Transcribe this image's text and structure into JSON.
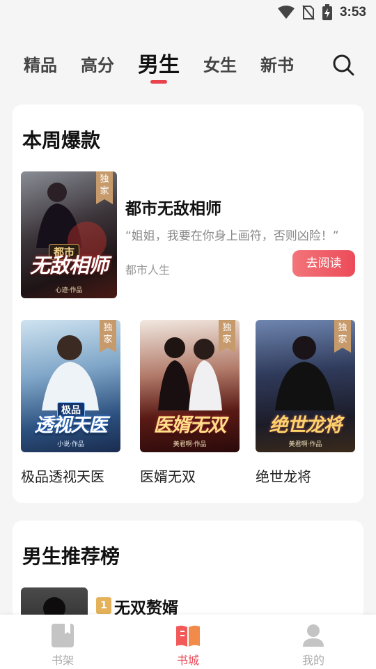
{
  "status_bar": {
    "time": "3:53"
  },
  "tabs": [
    {
      "label": "精品"
    },
    {
      "label": "高分"
    },
    {
      "label": "男生"
    },
    {
      "label": "女生"
    },
    {
      "label": "新书"
    }
  ],
  "weekly_hot": {
    "title": "本周爆款",
    "featured": {
      "name": "都市无敌相师",
      "cover_title": "无敌相师",
      "cover_tag": "都市",
      "cover_author": "心迹·作品",
      "badge": "独家",
      "quote": "“姐姐，我要在你身上画符，否则凶险！”",
      "category": "都市人生",
      "read_button": "去阅读"
    },
    "books": [
      {
        "name": "极品透视天医",
        "cover_title": "透视天医",
        "cover_tag": "极品",
        "cover_author": "小说·作品",
        "badge": "独家"
      },
      {
        "name": "医婿无双",
        "cover_title": "医婿无双",
        "cover_tag": "",
        "cover_author": "美君啊·作品",
        "badge": "独家"
      },
      {
        "name": "绝世龙将",
        "cover_title": "绝世龙将",
        "cover_tag": "",
        "cover_author": "美君啊·作品",
        "badge": "独家"
      }
    ]
  },
  "ranking": {
    "title": "男生推荐榜",
    "items": [
      {
        "rank": "1",
        "name": "无双赘婿"
      }
    ]
  },
  "bottom_nav": [
    {
      "label": "书架"
    },
    {
      "label": "书城"
    },
    {
      "label": "我的"
    }
  ],
  "colors": {
    "accent": "#ec4b59",
    "badge": "#c79a6c",
    "rank_gold": "#e3b25a"
  }
}
